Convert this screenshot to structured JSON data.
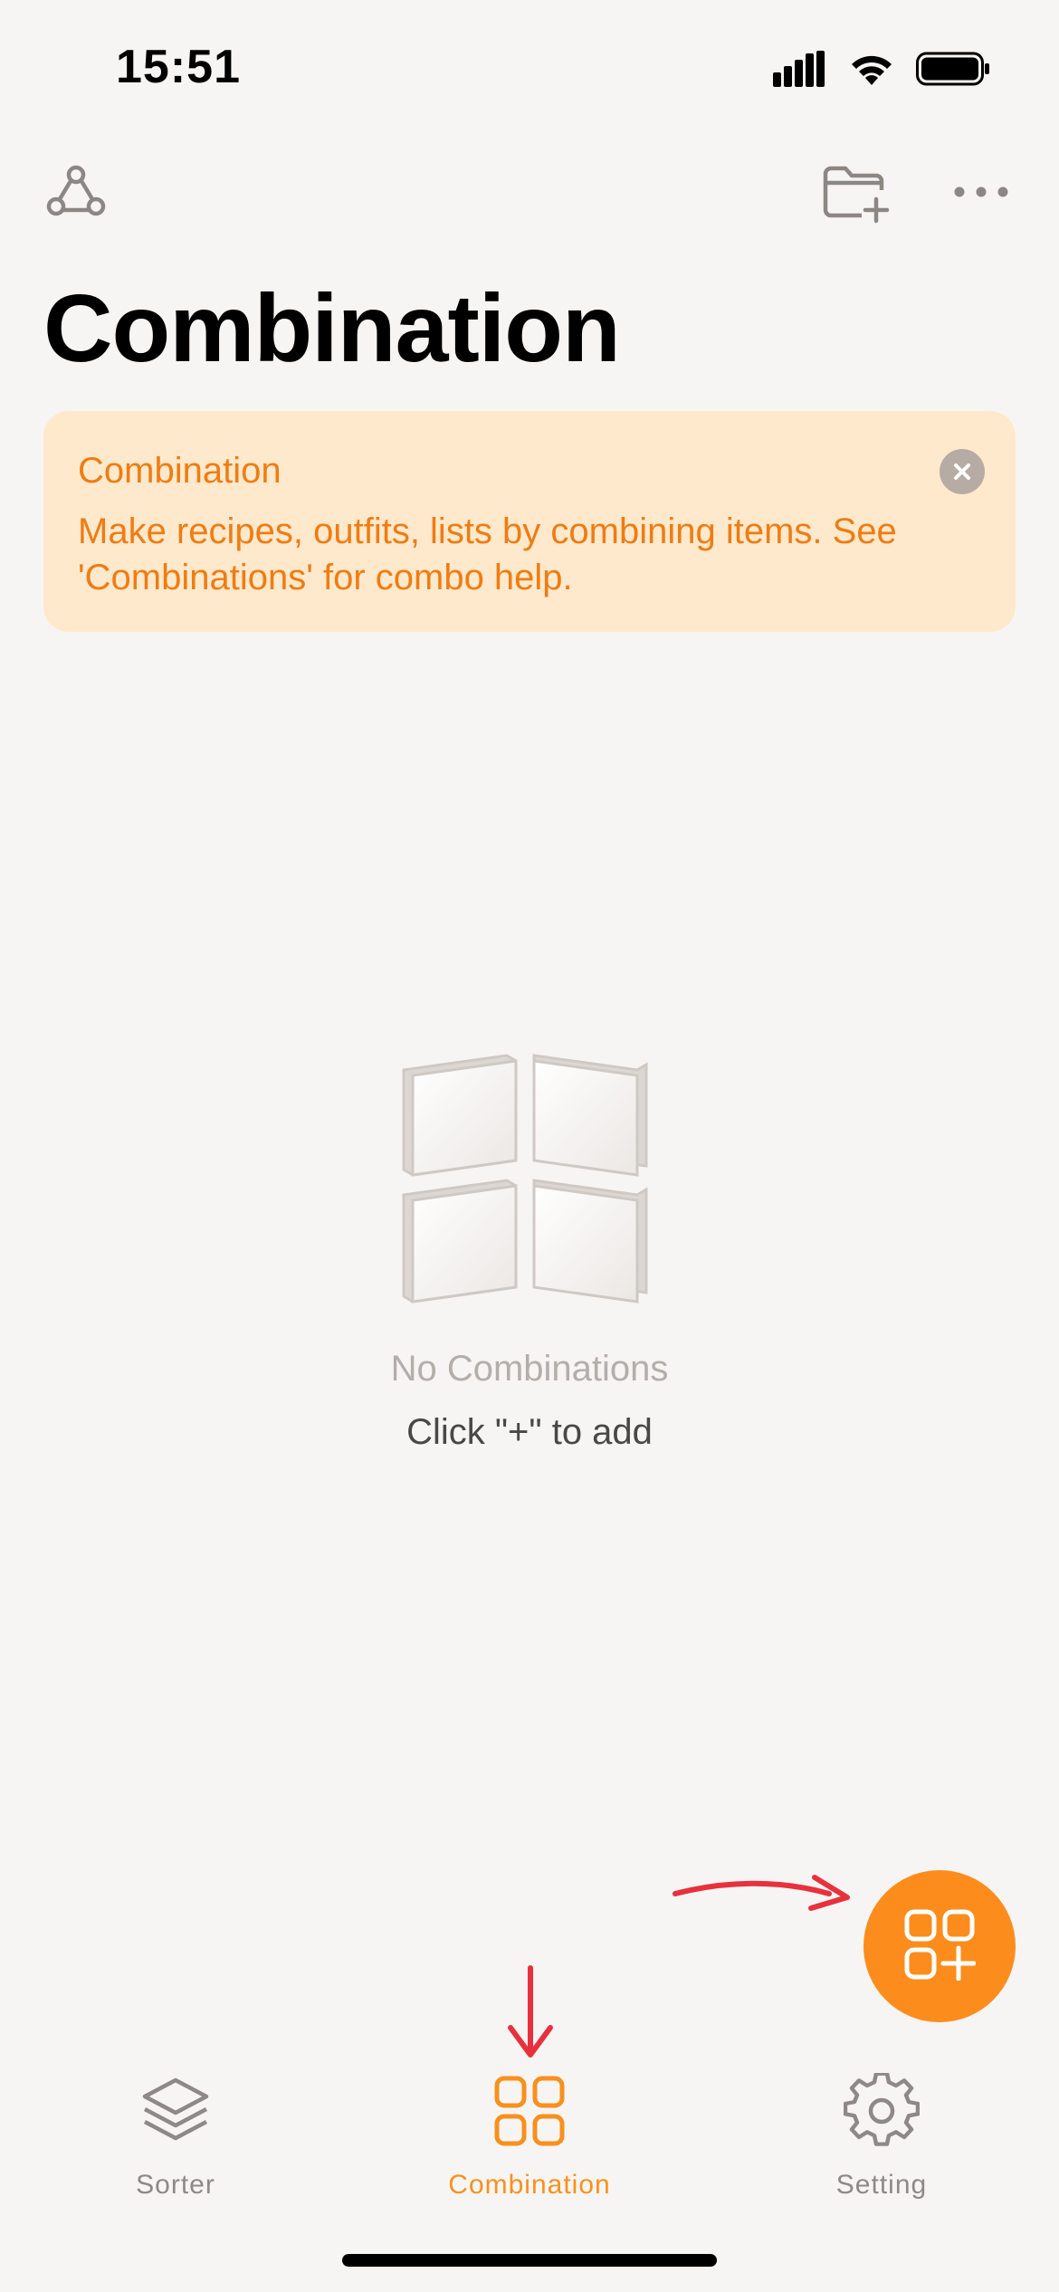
{
  "status_bar": {
    "time": "15:51",
    "icons": [
      "cellular-signal-icon",
      "wifi-icon",
      "battery-icon"
    ]
  },
  "toolbar": {
    "left_icon": "share-nodes-icon",
    "right_icons": [
      "add-folder-icon",
      "more-icon"
    ]
  },
  "page": {
    "title": "Combination"
  },
  "tip": {
    "title": "Combination",
    "text": "Make recipes, outfits, lists by combining items. See 'Combinations' for combo help.",
    "close_icon": "close-icon"
  },
  "empty_state": {
    "title": "No Combinations",
    "subtitle": "Click \"+\" to add",
    "illustration_icon": "four-tiles-icon"
  },
  "fab": {
    "icon": "add-combination-icon"
  },
  "tab_bar": {
    "tabs": [
      {
        "label": "Sorter",
        "icon": "layers-icon",
        "active": false
      },
      {
        "label": "Combination",
        "icon": "grid-icon",
        "active": true
      },
      {
        "label": "Setting",
        "icon": "gear-icon",
        "active": false
      }
    ]
  },
  "colors": {
    "background": "#f7f5f3",
    "accent": "#fc8d1c",
    "tip_background": "#ffe9cc",
    "tip_text": "#f07c12",
    "annotation": "#e8313c"
  }
}
